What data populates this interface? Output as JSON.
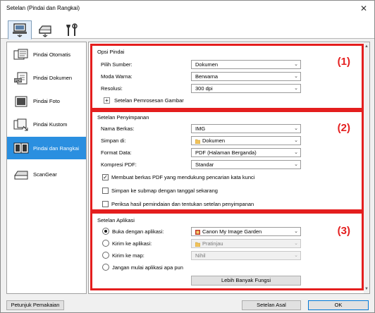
{
  "window": {
    "title": "Setelan (Pindai dan Rangkai)"
  },
  "sidebar": {
    "items": [
      {
        "label": "Pindai Otomatis"
      },
      {
        "label": "Pindai Dokumen"
      },
      {
        "label": "Pindai Foto"
      },
      {
        "label": "Pindai Kustom"
      },
      {
        "label": "Pindai dan Rangkai"
      },
      {
        "label": "ScanGear"
      }
    ]
  },
  "scan_options": {
    "title": "Opsi Pindai",
    "number": "(1)",
    "source_label": "Pilih Sumber:",
    "source_value": "Dokumen",
    "color_label": "Moda Warna:",
    "color_value": "Berwarna",
    "resolution_label": "Resolusi:",
    "resolution_value": "300 dpi",
    "image_processing_label": "Setelan Pemrosesan Gambar"
  },
  "save_settings": {
    "title": "Setelan Penyimpanan",
    "number": "(2)",
    "filename_label": "Nama Berkas:",
    "filename_value": "IMG",
    "save_in_label": "Simpan di:",
    "save_in_value": "Dokumen",
    "format_label": "Format Data:",
    "format_value": "PDF (Halaman Berganda)",
    "compression_label": "Kompresi PDF:",
    "compression_value": "Standar",
    "check_keyword": "Membuat berkas PDF yang mendukung pencarian kata kunci",
    "check_subfolder": "Simpan ke submap dengan tanggal sekarang",
    "check_review": "Periksa hasil pemindaian dan tentukan setelan penyimpanan"
  },
  "app_settings": {
    "title": "Setelan Aplikasi",
    "number": "(3)",
    "open_app_label": "Buka dengan aplikasi:",
    "open_app_value": "Canon My Image Garden",
    "send_app_label": "Kirim ke aplikasi:",
    "send_app_value": "Pratinjau",
    "send_folder_label": "Kirim ke map:",
    "send_folder_value": "Nihil",
    "no_app_label": "Jangan mulai aplikasi apa pun",
    "more_functions_label": "Lebih Banyak Fungsi"
  },
  "footer": {
    "help_label": "Petunjuk Pemakaian",
    "defaults_label": "Setelan Asal",
    "ok_label": "OK"
  },
  "colors": {
    "highlight": "#e41e1e",
    "selected": "#2a8fe0"
  }
}
